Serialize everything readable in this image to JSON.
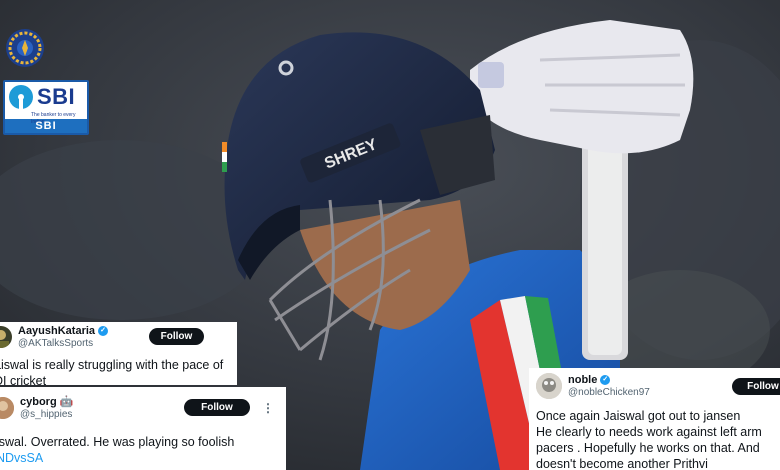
{
  "photo": {
    "helmet_text": "SHREY"
  },
  "branding": {
    "bcci_logo": "bcci-crest-icon",
    "sbi": {
      "wordmark": "SBI",
      "tagline": "The banker to every Indian",
      "bar_text": "SBI"
    }
  },
  "tweets": [
    {
      "display_name": "AayushKataria",
      "verified": true,
      "handle": "@AKTalksSports",
      "follow_label": "Follow",
      "lines": [
        "Jaiswal is really struggling with the pace of",
        "ODI cricket"
      ],
      "visible_lines": [
        "aiswal is really struggling with the pace of",
        "DI cricket"
      ]
    },
    {
      "display_name": "cyborg",
      "emoji": "🤖",
      "handle": "@s_hippies",
      "follow_label": "Follow",
      "more": "⋮",
      "visible_lines": [
        "iswal. Overrated. He was playing so foolish",
        "NDvsSA"
      ]
    },
    {
      "display_name": "noble",
      "verified": true,
      "handle": "@nobleChicken97",
      "follow_label": "Follow",
      "visible_lines": [
        "Once again Jaiswal got out to jansen",
        "He clearly to needs work against left arm",
        "pacers . Hopefully he works on that. And",
        "doesn't become another Prithvi"
      ]
    }
  ],
  "colors": {
    "helmet": "#1b2640",
    "jersey": "#1f5fc0",
    "glove": "#e8e8ee",
    "follow_button": "#0f1419",
    "hashtag": "#1d9bf0",
    "verified": "#1d9bf0"
  }
}
